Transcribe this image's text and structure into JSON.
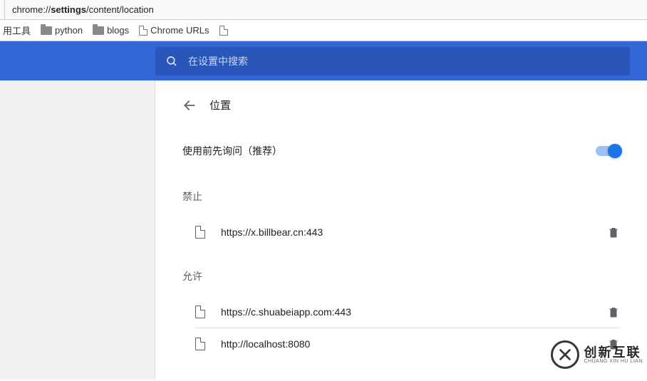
{
  "address_bar": {
    "url_prefix": "chrome://",
    "url_bold": "settings",
    "url_suffix": "/content/location"
  },
  "bookmarks": {
    "item_tools": "用工具",
    "item_python": "python",
    "item_blogs": "blogs",
    "item_chrome_urls": "Chrome URLs"
  },
  "search": {
    "placeholder": "在设置中搜索"
  },
  "page": {
    "title": "位置",
    "toggle_label": "使用前先询问（推荐）",
    "section_block": "禁止",
    "section_allow": "允许"
  },
  "blocked_sites": [
    {
      "url": "https://x.billbear.cn:443"
    }
  ],
  "allowed_sites": [
    {
      "url": "https://c.shuabeiapp.com:443"
    },
    {
      "url": "http://localhost:8080"
    }
  ],
  "watermark": {
    "cn": "创新互联",
    "en": "CHUANG XIN HU LIAN"
  }
}
